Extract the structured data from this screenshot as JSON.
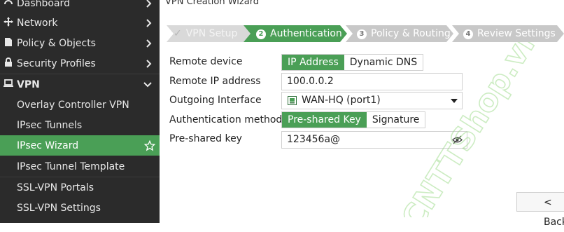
{
  "sidebar": {
    "items": [
      {
        "label": "Dashboard",
        "icon": "dashboard-icon"
      },
      {
        "label": "Network",
        "icon": "network-icon"
      },
      {
        "label": "Policy & Objects",
        "icon": "policy-icon"
      },
      {
        "label": "Security Profiles",
        "icon": "lock-icon"
      },
      {
        "label": "VPN",
        "icon": "monitor-icon"
      },
      {
        "label": "Overlay Controller VPN"
      },
      {
        "label": "IPsec Tunnels"
      },
      {
        "label": "IPsec Wizard"
      },
      {
        "label": "IPsec Tunnel Template"
      },
      {
        "label": "SSL-VPN Portals"
      },
      {
        "label": "SSL-VPN Settings"
      }
    ]
  },
  "page": {
    "title": "VPN Creation Wizard"
  },
  "wizard": {
    "steps": [
      {
        "number": "✓",
        "label": "VPN Setup"
      },
      {
        "number": "2",
        "label": "Authentication"
      },
      {
        "number": "3",
        "label": "Policy & Routing"
      },
      {
        "number": "4",
        "label": "Review Settings"
      }
    ]
  },
  "form": {
    "remote_device": {
      "label": "Remote device",
      "options": [
        "IP Address",
        "Dynamic DNS"
      ],
      "selected": "IP Address"
    },
    "remote_ip": {
      "label": "Remote IP address",
      "value": "100.0.0.2"
    },
    "outgoing_interface": {
      "label": "Outgoing Interface",
      "value": "WAN-HQ (port1)"
    },
    "auth_method": {
      "label": "Authentication method",
      "options": [
        "Pre-shared Key",
        "Signature"
      ],
      "selected": "Pre-shared Key"
    },
    "psk": {
      "label": "Pre-shared key",
      "value": "123456a@"
    }
  },
  "footer": {
    "back_label": "< Back"
  },
  "watermark": {
    "text": "CNTTShop.vn"
  },
  "colors": {
    "accent": "#4a9f56",
    "sidebar_bg": "#2b2b2b"
  }
}
